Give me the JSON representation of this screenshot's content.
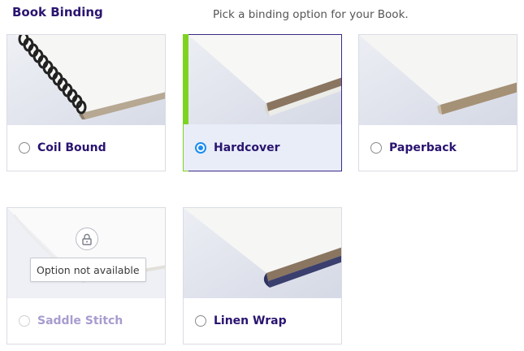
{
  "section": {
    "title": "Book Binding",
    "subtitle": "Pick a binding option for your Book."
  },
  "options": [
    {
      "label": "Coil Bound",
      "selected": false,
      "disabled": false,
      "image": "coil-bound-book-image"
    },
    {
      "label": "Hardcover",
      "selected": true,
      "disabled": false,
      "image": "hardcover-book-image"
    },
    {
      "label": "Paperback",
      "selected": false,
      "disabled": false,
      "image": "paperback-book-image"
    },
    {
      "label": "Saddle Stitch",
      "selected": false,
      "disabled": true,
      "image": "saddle-stitch-book-image",
      "tooltip": "Option not available",
      "icon": "lock-icon"
    },
    {
      "label": "Linen Wrap",
      "selected": false,
      "disabled": false,
      "image": "linen-wrap-book-image"
    }
  ],
  "colors": {
    "title": "#2a1470",
    "selected_accent": "#7ed321",
    "radio_checked": "#1a8cf0",
    "selected_footer_bg": "#e8edf8",
    "disabled_label": "#a89ccf"
  }
}
